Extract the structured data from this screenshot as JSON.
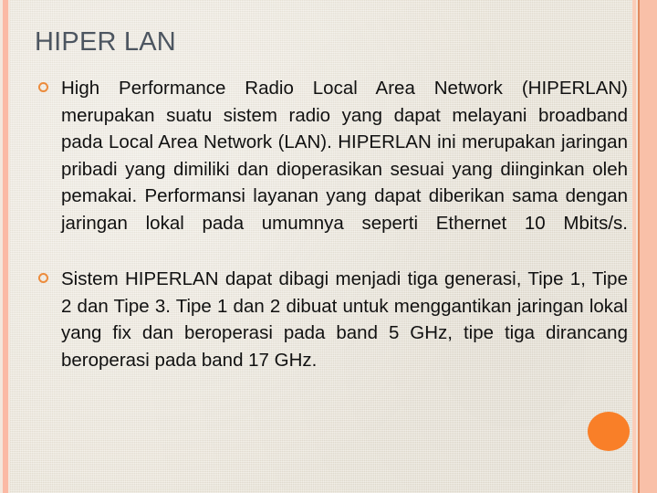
{
  "slide": {
    "title": "HIPER LAN",
    "background_color": "#e9e3d6",
    "title_color": "#4c5560",
    "accent_color": "#f97f28",
    "bullet_color": "#ec8b3c",
    "edge_stripe_color": "#fbb9a4",
    "right_band_color": "#f9c0a8",
    "bullets": [
      {
        "marker": "hollow-circle-bullet",
        "text": "High Performance Radio Local Area Network (HIPERLAN) merupakan suatu sistem radio yang dapat melayani broadband pada Local Area Network (LAN). HIPERLAN ini merupakan jaringan pribadi yang dimiliki dan dioperasikan sesuai yang diinginkan oleh pemakai. Performansi layanan yang dapat diberikan sama dengan jaringan lokal pada umumnya seperti Ethernet 10 Mbits/s."
      },
      {
        "marker": "hollow-circle-bullet",
        "text": "Sistem HIPERLAN dapat dibagi menjadi tiga generasi, Tipe 1, Tipe 2 dan Tipe 3. Tipe 1 dan 2 dibuat untuk menggantikan jaringan lokal yang fix dan beroperasi pada band 5 GHz, tipe tiga dirancang beroperasi pada band 17 GHz."
      }
    ],
    "decorations": {
      "corner_dot": "orange-circle-decoration"
    }
  }
}
